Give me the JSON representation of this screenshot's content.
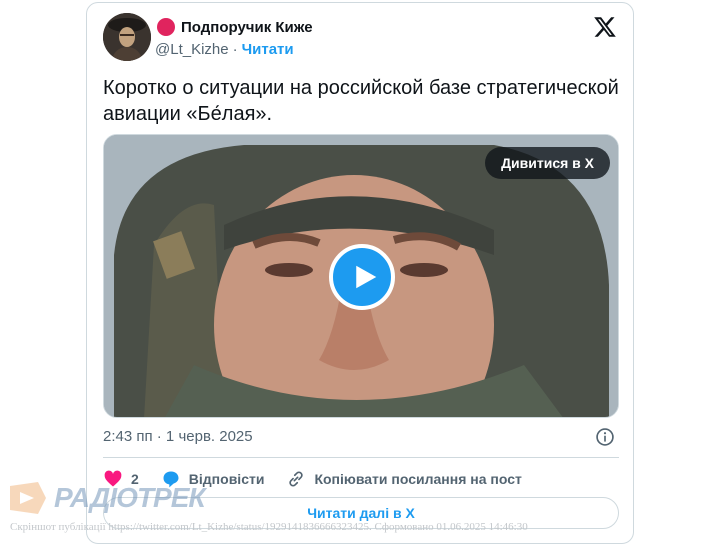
{
  "author": {
    "display_name": "Подпоручик Киже",
    "handle": "@Lt_Kizhe",
    "separator": "·",
    "follow_label": "Читати"
  },
  "tweet": {
    "text": "Коротко о ситуации на российской базе стратегической авиации «Бе́лая».",
    "watch_label": "Дивитися в X",
    "timestamp": "2:43 пп · 1 черв. 2025"
  },
  "actions": {
    "like_count": "2",
    "reply_label": "Відповісти",
    "copy_label": "Копіювати посилання на пост"
  },
  "read_more_label": "Читати далі в X",
  "watermark": {
    "logo_text": "РАДІОТРЕК",
    "screenshot_note": "Скріншот публікації https://twitter.com/Lt_Kizhe/status/1929141836666323425. Сформовано 01.06.2025 14:46:30"
  },
  "colors": {
    "accent": "#1d9bf0",
    "like": "#f91880",
    "verified_dot": "#e0245e"
  },
  "icons": [
    "x-logo-icon",
    "play-icon",
    "info-icon",
    "heart-icon",
    "reply-icon",
    "link-icon"
  ]
}
